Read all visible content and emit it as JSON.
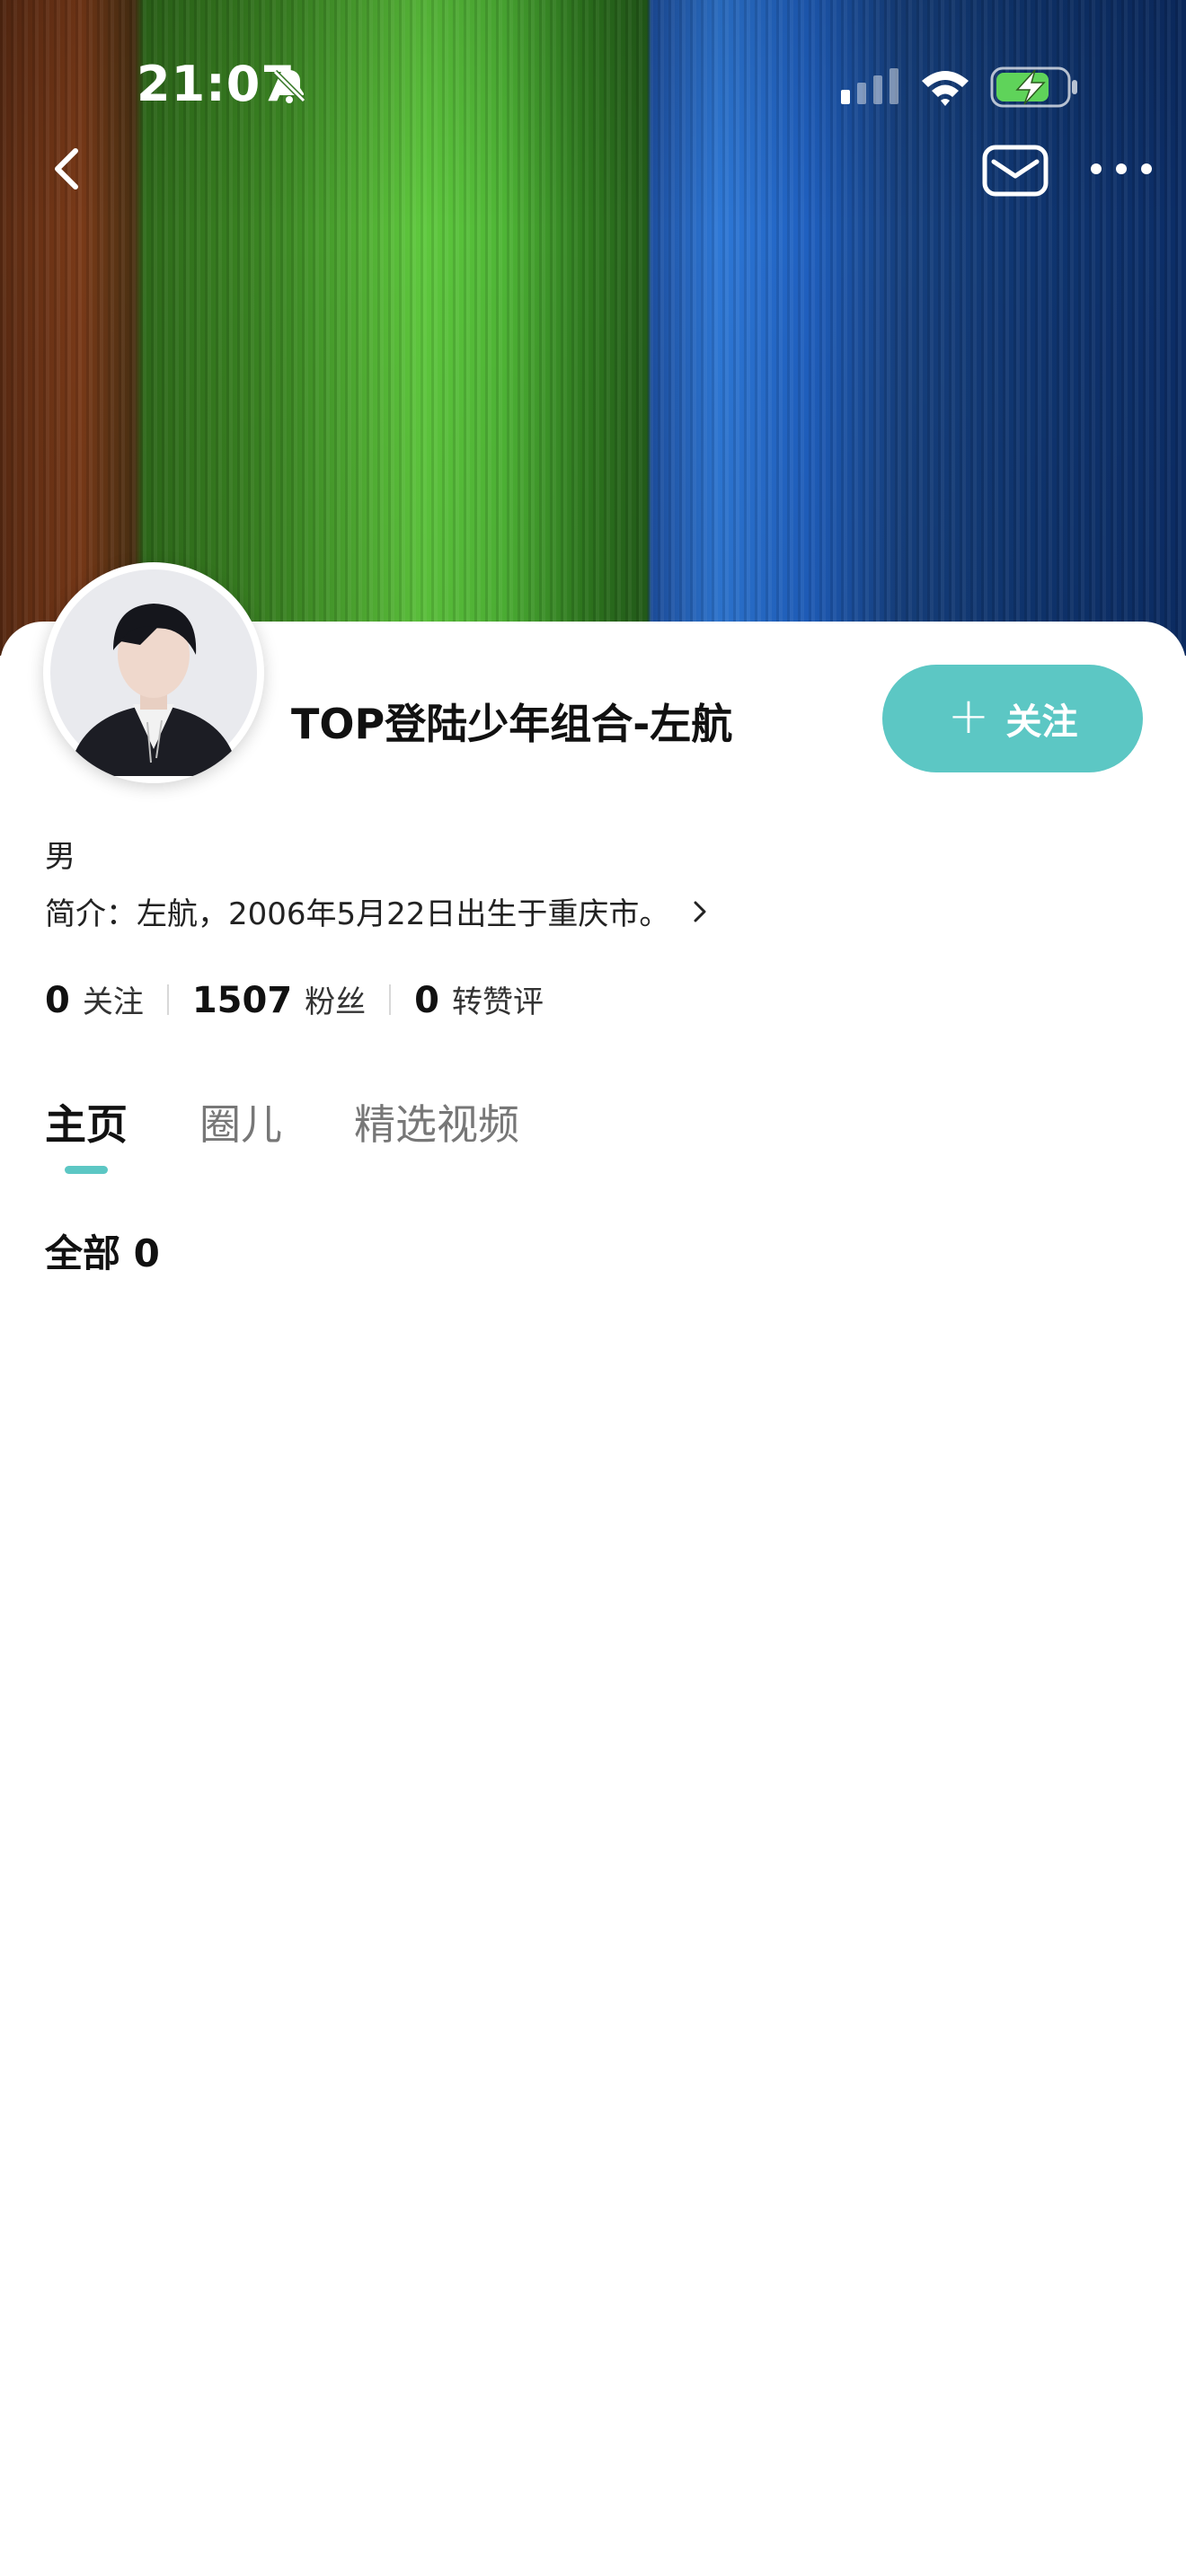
{
  "status_bar": {
    "time": "21:07",
    "icons": [
      "bell-muted-icon",
      "cellular-signal-icon",
      "wifi-icon",
      "battery-charging-icon"
    ]
  },
  "nav": {
    "icons": [
      "back-icon",
      "mail-icon",
      "more-icon"
    ]
  },
  "profile": {
    "name": "TOP登陆少年组合-左航",
    "follow_button_label": "关注",
    "gender": "男",
    "bio": "简介：左航，2006年5月22日出生于重庆市。"
  },
  "stats": [
    {
      "value": "0",
      "label": "关注"
    },
    {
      "value": "1507",
      "label": "粉丝"
    },
    {
      "value": "0",
      "label": "转赞评"
    }
  ],
  "tabs": [
    {
      "label": "主页",
      "active": true
    },
    {
      "label": "圈儿",
      "active": false
    },
    {
      "label": "精选视频",
      "active": false
    }
  ],
  "content": {
    "section_title": "全部 0"
  },
  "colors": {
    "accent": "#5cc7c4"
  }
}
